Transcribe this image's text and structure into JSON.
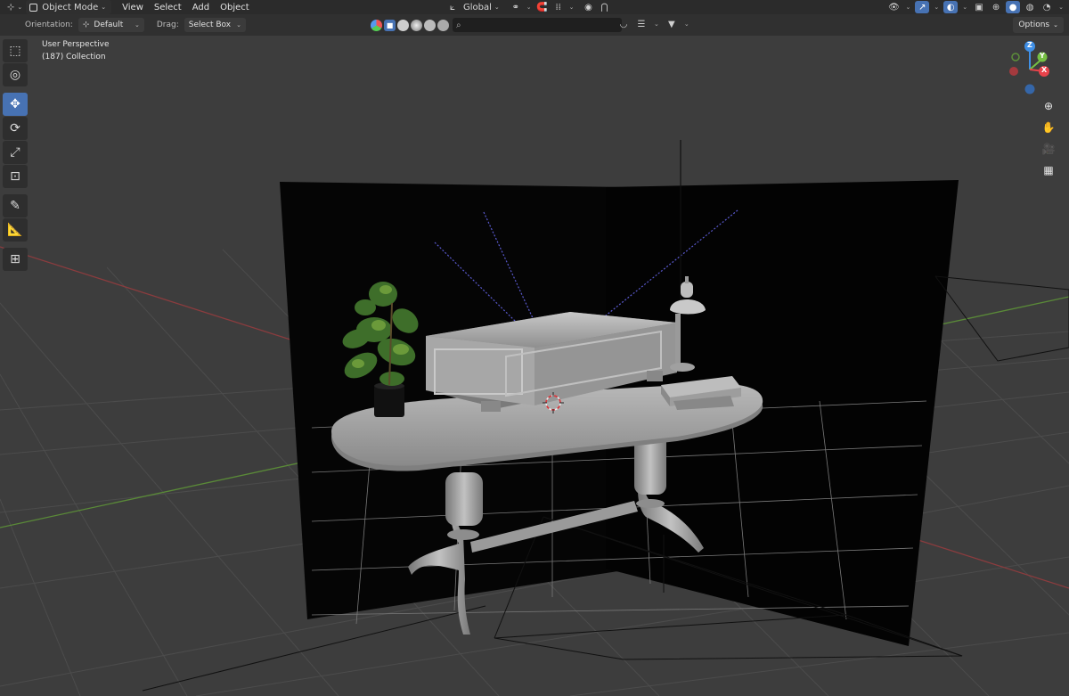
{
  "header": {
    "mode_label": "Object Mode",
    "menus": [
      "View",
      "Select",
      "Add",
      "Object"
    ],
    "transform_orientation": "Global"
  },
  "tool_settings": {
    "orientation_label": "Orientation:",
    "orientation_value": "Default",
    "drag_label": "Drag:",
    "drag_value": "Select Box",
    "options_label": "Options"
  },
  "search": {
    "placeholder": ""
  },
  "viewport_info": {
    "perspective": "User Perspective",
    "collection": "(187) Collection"
  },
  "gizmo": {
    "z_label": "Z",
    "y_label": "Y",
    "x_label": "X"
  },
  "colors": {
    "accent": "#4772b3",
    "axis_x": "#e8434b",
    "axis_y": "#76c043",
    "axis_z": "#3f8fe6",
    "grid": "#4a4a4a",
    "background": "#3d3d3d"
  },
  "icons": {
    "tools": [
      "select-box-icon",
      "cursor-icon",
      "move-icon",
      "rotate-icon",
      "scale-icon",
      "transform-icon",
      "annotate-icon",
      "measure-icon",
      "add-cube-icon"
    ],
    "nav": [
      "zoom-icon",
      "pan-hand-icon",
      "camera-icon",
      "ortho-grid-icon"
    ]
  }
}
